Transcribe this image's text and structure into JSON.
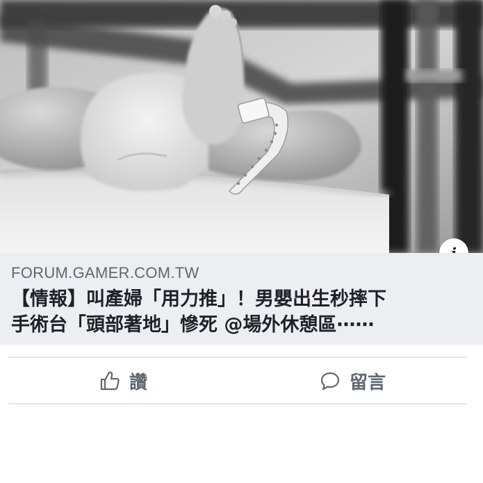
{
  "post": {
    "link_domain": "FORUM.GAMER.COM.TW",
    "headline_line1": "【情報】叫產婦「用力推」！男嬰出生秒摔下",
    "headline_line2": "手術台「頭部著地」慘死 @場外休憩區⋯⋯",
    "info_glyph": "i"
  },
  "actions": {
    "like_label": "讚",
    "like_icon": "thumbs-up-icon",
    "comment_label": "留言",
    "comment_icon": "speech-bubble-icon"
  },
  "colors": {
    "caption_bg": "#eceef2",
    "domain_text": "#62666d",
    "headline_text": "#1d2129",
    "action_text": "#606770",
    "divider": "#e4e6ea"
  }
}
